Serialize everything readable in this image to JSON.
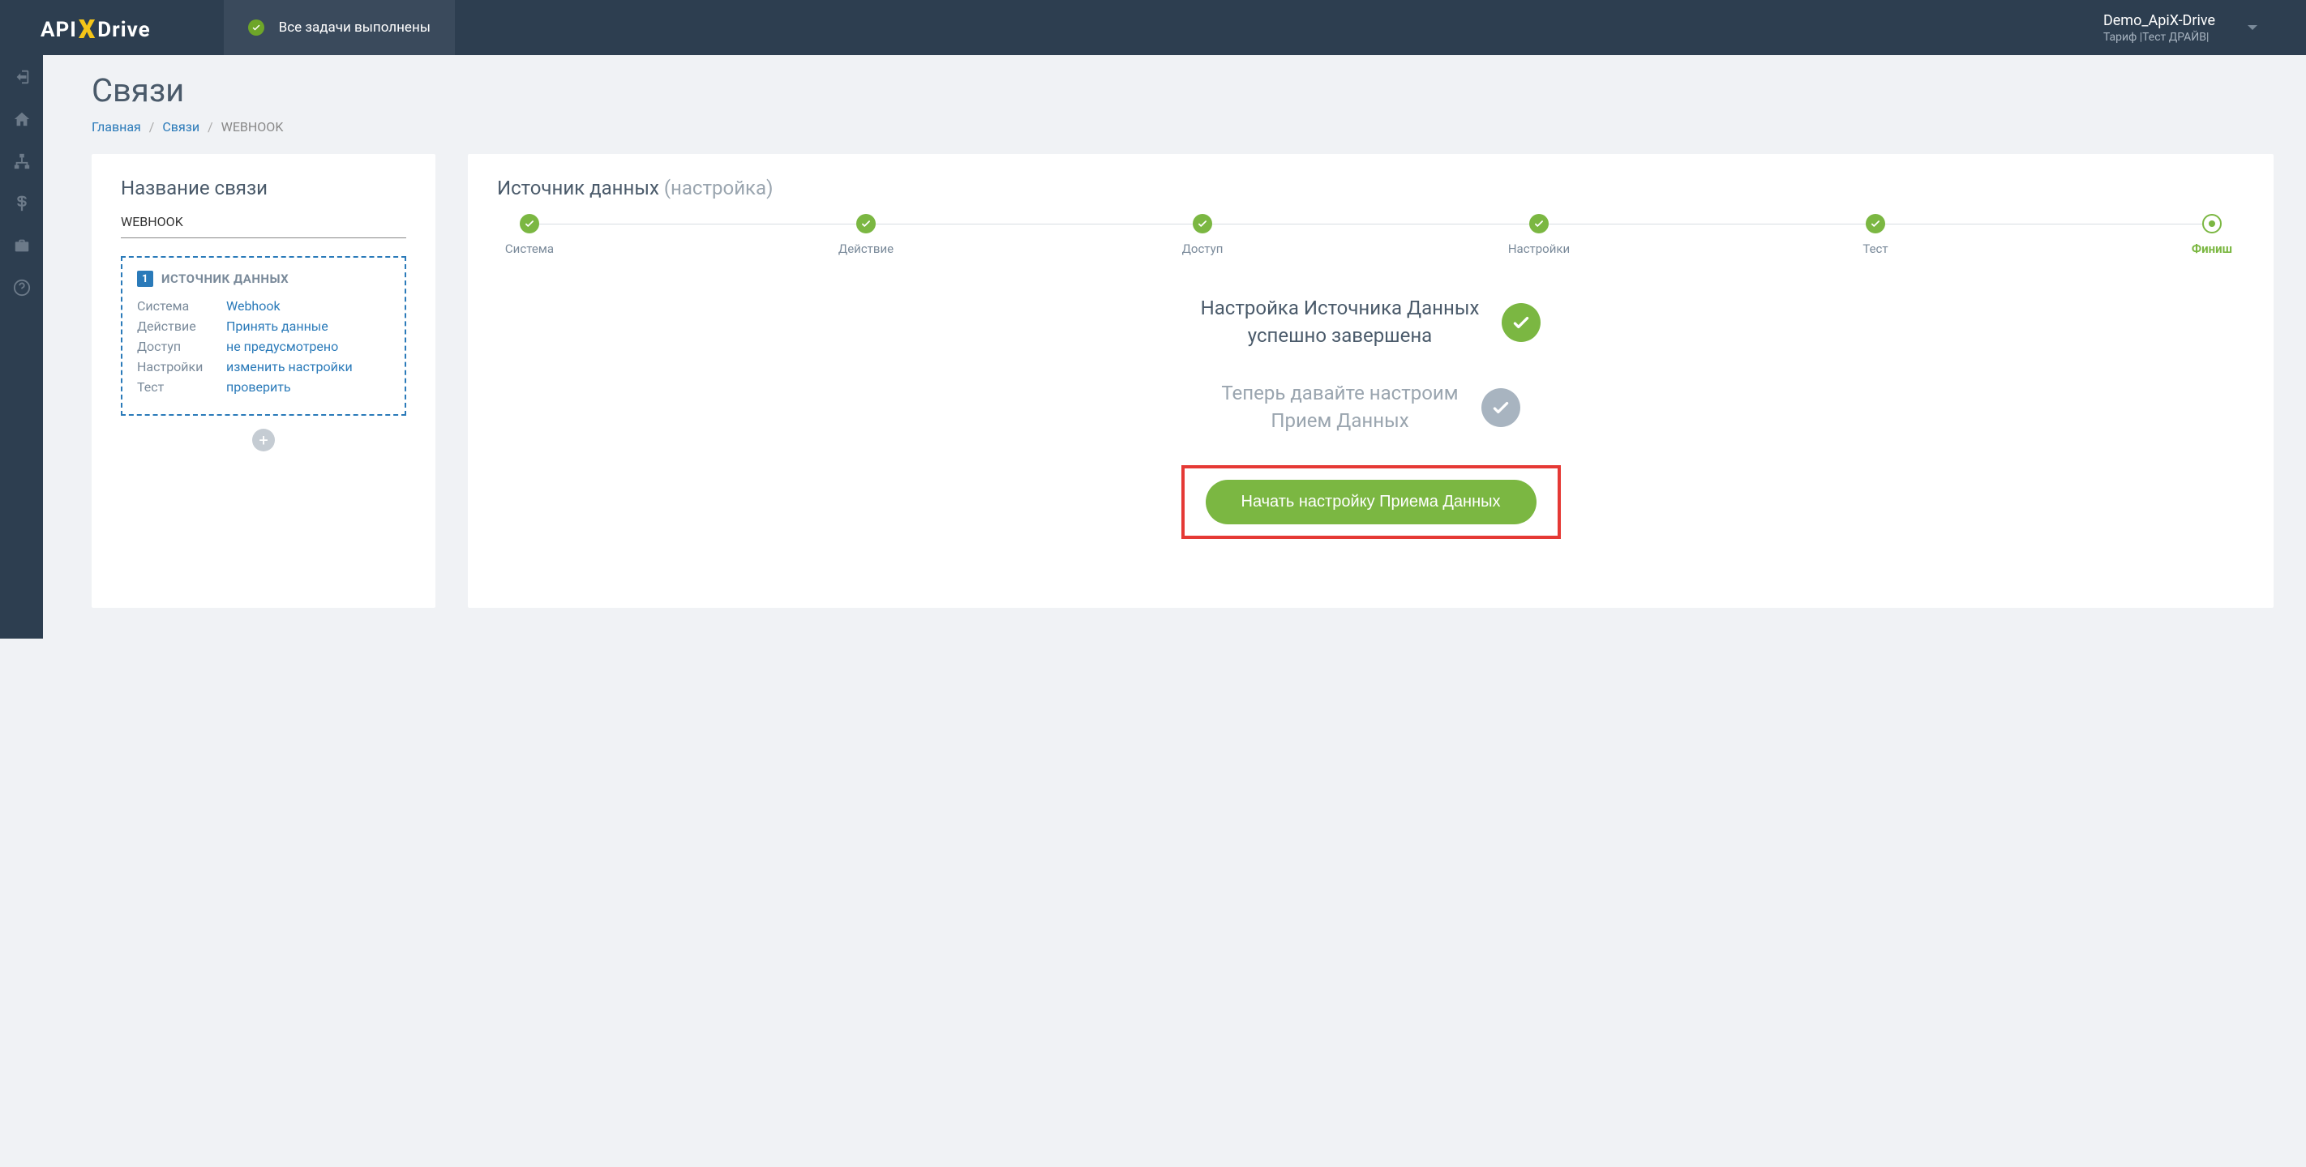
{
  "header": {
    "logo_api": "API",
    "logo_drive": "Drive",
    "status_text": "Все задачи выполнены",
    "user_name": "Demo_ApiX-Drive",
    "user_plan": "Тариф |Тест ДРАЙВ|"
  },
  "page": {
    "title": "Связи"
  },
  "breadcrumb": {
    "home": "Главная",
    "links": "Связи",
    "current": "WEBHOOK"
  },
  "left_panel": {
    "heading": "Название связи",
    "conn_name": "WEBHOOK",
    "source_badge": "1",
    "source_title": "ИСТОЧНИК ДАННЫХ",
    "kv": {
      "system_label": "Система",
      "system_value": "Webhook",
      "action_label": "Действие",
      "action_value": "Принять данные",
      "access_label": "Доступ",
      "access_value": "не предусмотрено",
      "settings_label": "Настройки",
      "settings_value": "изменить настройки",
      "test_label": "Тест",
      "test_value": "проверить"
    }
  },
  "right_panel": {
    "heading_main": "Источник данных",
    "heading_sub": "(настройка)",
    "steps": {
      "s1": "Система",
      "s2": "Действие",
      "s3": "Доступ",
      "s4": "Настройки",
      "s5": "Тест",
      "s6": "Финиш"
    },
    "status1_line1": "Настройка Источника Данных",
    "status1_line2": "успешно завершена",
    "status2_line1": "Теперь давайте настроим",
    "status2_line2": "Прием Данных",
    "cta_label": "Начать настройку Приема Данных"
  }
}
